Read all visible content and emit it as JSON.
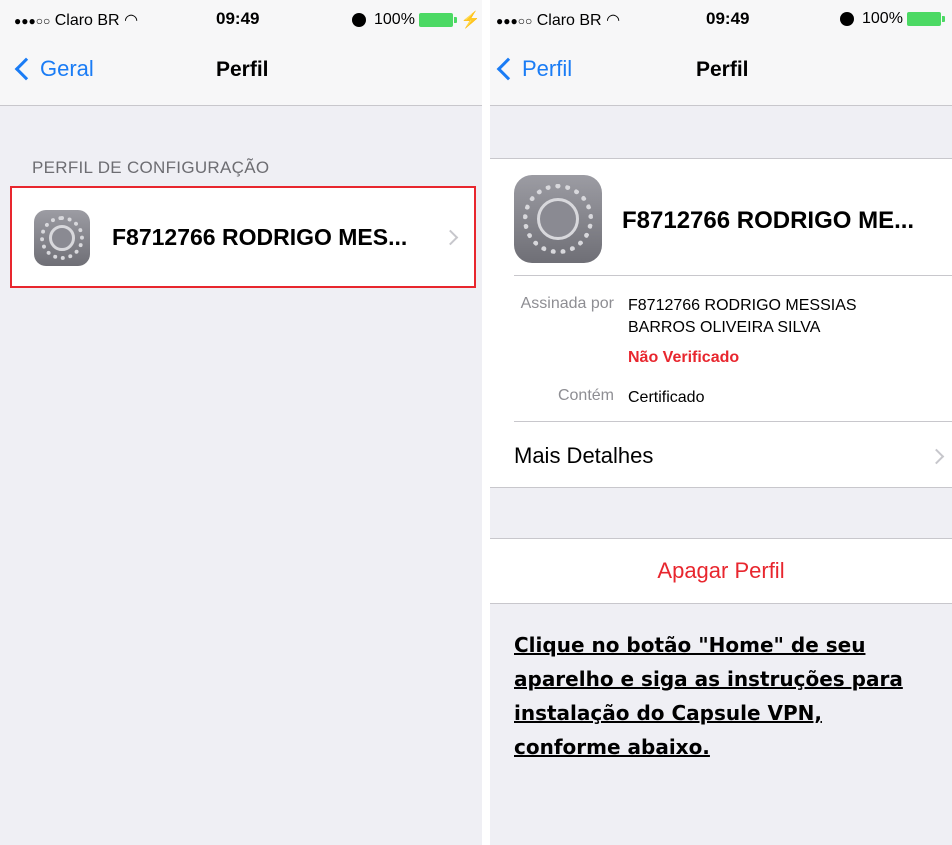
{
  "left": {
    "status": {
      "carrier": "Claro BR",
      "signal_dots": "●●●○○",
      "time": "09:49",
      "battery": "100%",
      "charging": "⚡"
    },
    "nav": {
      "back_label": "Geral",
      "title": "Perfil"
    },
    "section_header": "PERFIL DE CONFIGURAÇÃO",
    "profile_name": "F8712766 RODRIGO MES..."
  },
  "right": {
    "status": {
      "carrier": "Claro BR",
      "signal_dots": "●●●○○",
      "time": "09:49",
      "battery": "100%"
    },
    "nav": {
      "back_label": "Perfil",
      "title": "Perfil"
    },
    "profile_name": "F8712766 RODRIGO ME...",
    "signed_by_label": "Assinada por",
    "signed_by_value_line1": "F8712766 RODRIGO MESSIAS",
    "signed_by_value_line2": "BARROS OLIVEIRA SILVA",
    "verification_status": "Não Verificado",
    "contains_label": "Contém",
    "contains_value": "Certificado",
    "more_details": "Mais Detalhes",
    "delete_profile": "Apagar Perfil",
    "instruction": "Clique no botão \"Home\" de seu aparelho e siga as instruções para instalação do Capsule VPN, conforme abaixo."
  },
  "colors": {
    "accent": "#1a7cf5",
    "destructive": "#e8262e",
    "battery": "#4cd964",
    "highlight_border": "#e8262e"
  },
  "icons": [
    "wifi-icon",
    "alarm-icon",
    "battery-icon",
    "chevron-left-icon",
    "chevron-right-icon",
    "settings-gear-icon"
  ]
}
